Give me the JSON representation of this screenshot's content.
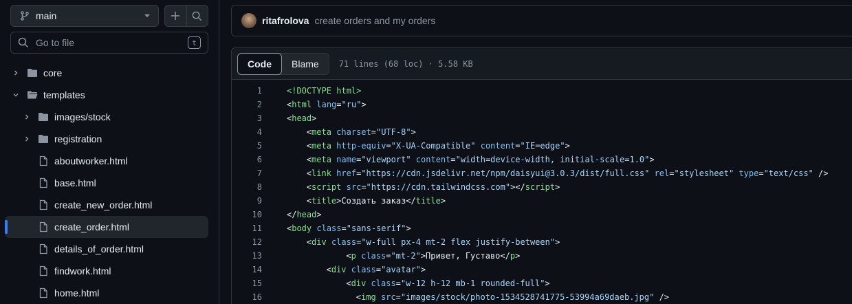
{
  "sidebar": {
    "branch": "main",
    "goto_placeholder": "Go to file",
    "goto_shortcut": "t",
    "tree": [
      {
        "label": "core",
        "type": "folder",
        "depth": 0,
        "expanded": false
      },
      {
        "label": "templates",
        "type": "folder",
        "depth": 0,
        "expanded": true
      },
      {
        "label": "images/stock",
        "type": "folder",
        "depth": 1,
        "expanded": false
      },
      {
        "label": "registration",
        "type": "folder",
        "depth": 1,
        "expanded": false
      },
      {
        "label": "aboutworker.html",
        "type": "file",
        "depth": 1
      },
      {
        "label": "base.html",
        "type": "file",
        "depth": 1
      },
      {
        "label": "create_new_order.html",
        "type": "file",
        "depth": 1
      },
      {
        "label": "create_order.html",
        "type": "file",
        "depth": 1,
        "selected": true
      },
      {
        "label": "details_of_order.html",
        "type": "file",
        "depth": 1
      },
      {
        "label": "findwork.html",
        "type": "file",
        "depth": 1
      },
      {
        "label": "home.html",
        "type": "file",
        "depth": 1
      }
    ]
  },
  "commit": {
    "author": "ritafrolova",
    "message": "create orders and my orders"
  },
  "file": {
    "tabs": [
      "Code",
      "Blame"
    ],
    "active_tab": "Code",
    "meta": "71 lines (68 loc) · 5.58 KB"
  },
  "code_lines": [
    {
      "n": "1",
      "indent": 0,
      "parts": [
        [
          "t",
          "<!DOCTYPE html>"
        ]
      ]
    },
    {
      "n": "2",
      "indent": 0,
      "parts": [
        [
          "p",
          "<"
        ],
        [
          "t",
          "html"
        ],
        [
          "p",
          " "
        ],
        [
          "a",
          "lang"
        ],
        [
          "p",
          "="
        ],
        [
          "s",
          "\"ru\""
        ],
        [
          "p",
          ">"
        ]
      ]
    },
    {
      "n": "3",
      "indent": 0,
      "parts": [
        [
          "p",
          "<"
        ],
        [
          "t",
          "head"
        ],
        [
          "p",
          ">"
        ]
      ]
    },
    {
      "n": "4",
      "indent": 4,
      "parts": [
        [
          "p",
          "<"
        ],
        [
          "t",
          "meta"
        ],
        [
          "p",
          " "
        ],
        [
          "a",
          "charset"
        ],
        [
          "p",
          "="
        ],
        [
          "s",
          "\"UTF-8\""
        ],
        [
          "p",
          ">"
        ]
      ]
    },
    {
      "n": "5",
      "indent": 4,
      "parts": [
        [
          "p",
          "<"
        ],
        [
          "t",
          "meta"
        ],
        [
          "p",
          " "
        ],
        [
          "a",
          "http-equiv"
        ],
        [
          "p",
          "="
        ],
        [
          "s",
          "\"X-UA-Compatible\""
        ],
        [
          "p",
          " "
        ],
        [
          "a",
          "content"
        ],
        [
          "p",
          "="
        ],
        [
          "s",
          "\"IE=edge\""
        ],
        [
          "p",
          ">"
        ]
      ]
    },
    {
      "n": "6",
      "indent": 4,
      "parts": [
        [
          "p",
          "<"
        ],
        [
          "t",
          "meta"
        ],
        [
          "p",
          " "
        ],
        [
          "a",
          "name"
        ],
        [
          "p",
          "="
        ],
        [
          "s",
          "\"viewport\""
        ],
        [
          "p",
          " "
        ],
        [
          "a",
          "content"
        ],
        [
          "p",
          "="
        ],
        [
          "s",
          "\"width=device-width, initial-scale=1.0\""
        ],
        [
          "p",
          ">"
        ]
      ]
    },
    {
      "n": "7",
      "indent": 4,
      "parts": [
        [
          "p",
          "<"
        ],
        [
          "t",
          "link"
        ],
        [
          "p",
          " "
        ],
        [
          "a",
          "href"
        ],
        [
          "p",
          "="
        ],
        [
          "s",
          "\"https://cdn.jsdelivr.net/npm/daisyui@3.0.3/dist/full.css\""
        ],
        [
          "p",
          " "
        ],
        [
          "a",
          "rel"
        ],
        [
          "p",
          "="
        ],
        [
          "s",
          "\"stylesheet\""
        ],
        [
          "p",
          " "
        ],
        [
          "a",
          "type"
        ],
        [
          "p",
          "="
        ],
        [
          "s",
          "\"text/css\""
        ],
        [
          "p",
          " />"
        ]
      ]
    },
    {
      "n": "8",
      "indent": 4,
      "parts": [
        [
          "p",
          "<"
        ],
        [
          "t",
          "script"
        ],
        [
          "p",
          " "
        ],
        [
          "a",
          "src"
        ],
        [
          "p",
          "="
        ],
        [
          "s",
          "\"https://cdn.tailwindcss.com\""
        ],
        [
          "p",
          "></"
        ],
        [
          "t",
          "script"
        ],
        [
          "p",
          ">"
        ]
      ]
    },
    {
      "n": "9",
      "indent": 4,
      "parts": [
        [
          "p",
          "<"
        ],
        [
          "t",
          "title"
        ],
        [
          "p",
          ">Создать заказ</"
        ],
        [
          "t",
          "title"
        ],
        [
          "p",
          ">"
        ]
      ]
    },
    {
      "n": "10",
      "indent": 0,
      "parts": [
        [
          "p",
          "</"
        ],
        [
          "t",
          "head"
        ],
        [
          "p",
          ">"
        ]
      ]
    },
    {
      "n": "11",
      "indent": 0,
      "parts": [
        [
          "p",
          "<"
        ],
        [
          "t",
          "body"
        ],
        [
          "p",
          " "
        ],
        [
          "a",
          "class"
        ],
        [
          "p",
          "="
        ],
        [
          "s",
          "\"sans-serif\""
        ],
        [
          "p",
          ">"
        ]
      ]
    },
    {
      "n": "12",
      "indent": 4,
      "parts": [
        [
          "p",
          "<"
        ],
        [
          "t",
          "div"
        ],
        [
          "p",
          " "
        ],
        [
          "a",
          "class"
        ],
        [
          "p",
          "="
        ],
        [
          "s",
          "\"w-full px-4 mt-2 flex justify-between\""
        ],
        [
          "p",
          ">"
        ]
      ]
    },
    {
      "n": "13",
      "indent": 12,
      "parts": [
        [
          "p",
          "<"
        ],
        [
          "t",
          "p"
        ],
        [
          "p",
          " "
        ],
        [
          "a",
          "class"
        ],
        [
          "p",
          "="
        ],
        [
          "s",
          "\"mt-2\""
        ],
        [
          "p",
          ">Привет, Густаво</"
        ],
        [
          "t",
          "p"
        ],
        [
          "p",
          ">"
        ]
      ]
    },
    {
      "n": "14",
      "indent": 8,
      "parts": [
        [
          "p",
          "<"
        ],
        [
          "t",
          "div"
        ],
        [
          "p",
          " "
        ],
        [
          "a",
          "class"
        ],
        [
          "p",
          "="
        ],
        [
          "s",
          "\"avatar\""
        ],
        [
          "p",
          ">"
        ]
      ]
    },
    {
      "n": "15",
      "indent": 12,
      "parts": [
        [
          "p",
          "<"
        ],
        [
          "t",
          "div"
        ],
        [
          "p",
          " "
        ],
        [
          "a",
          "class"
        ],
        [
          "p",
          "="
        ],
        [
          "s",
          "\"w-12 h-12 mb-1 rounded-full\""
        ],
        [
          "p",
          ">"
        ]
      ]
    },
    {
      "n": "16",
      "indent": 14,
      "parts": [
        [
          "p",
          "<"
        ],
        [
          "t",
          "img"
        ],
        [
          "p",
          " "
        ],
        [
          "a",
          "src"
        ],
        [
          "p",
          "="
        ],
        [
          "s",
          "\"images/stock/photo-1534528741775-53994a69daeb.jpg\""
        ],
        [
          "p",
          " />"
        ]
      ]
    }
  ],
  "colors": {
    "background": "#0d1117",
    "border": "#30363d",
    "tag": "#7ee787",
    "attribute": "#79c0ff",
    "string": "#a5d6ff",
    "accent": "#2f81f7",
    "muted": "#8d96a0"
  }
}
